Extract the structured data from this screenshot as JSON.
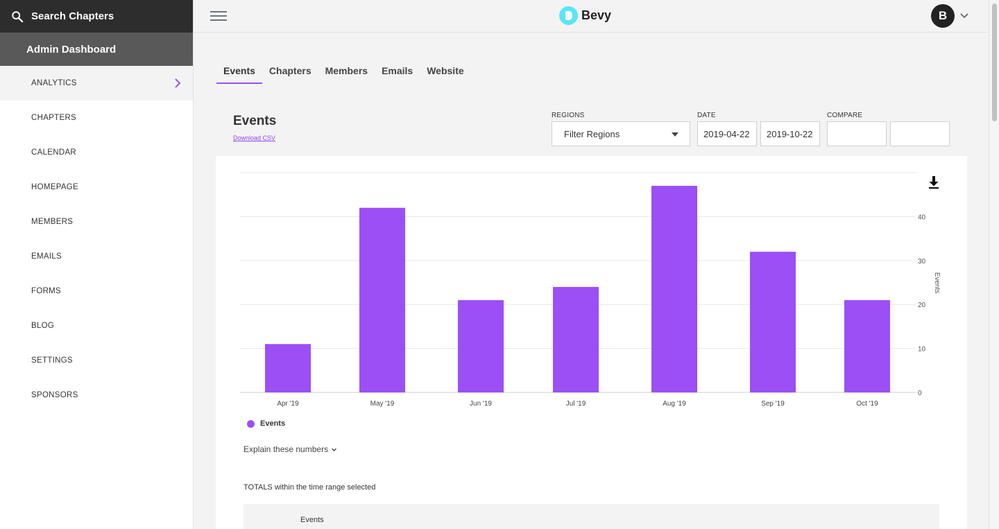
{
  "sidebar": {
    "search_label": "Search Chapters",
    "header": "Admin Dashboard",
    "items": [
      {
        "label": "ANALYTICS",
        "active": true
      },
      {
        "label": "CHAPTERS"
      },
      {
        "label": "CALENDAR"
      },
      {
        "label": "HOMEPAGE"
      },
      {
        "label": "MEMBERS"
      },
      {
        "label": "EMAILS"
      },
      {
        "label": "FORMS"
      },
      {
        "label": "BLOG"
      },
      {
        "label": "SETTINGS"
      },
      {
        "label": "SPONSORS"
      }
    ]
  },
  "header": {
    "logo_text": "Bevy",
    "avatar_initial": "B"
  },
  "tabs": [
    {
      "label": "Events",
      "active": true
    },
    {
      "label": "Chapters"
    },
    {
      "label": "Members"
    },
    {
      "label": "Emails"
    },
    {
      "label": "Website"
    }
  ],
  "section": {
    "title": "Events",
    "download_csv": "Download CSV"
  },
  "filters": {
    "regions_label": "REGIONS",
    "regions_value": "Filter Regions",
    "date_label": "DATE",
    "date_start": "2019-04-22",
    "date_end": "2019-10-22",
    "compare_label": "COMPARE",
    "compare_start": "",
    "compare_end": ""
  },
  "chart_data": {
    "type": "bar",
    "categories": [
      "Apr '19",
      "May '19",
      "Jun '19",
      "Jul '19",
      "Aug '19",
      "Sep '19",
      "Oct '19"
    ],
    "series": [
      {
        "name": "Events",
        "values": [
          11,
          42,
          21,
          24,
          47,
          32,
          21
        ]
      }
    ],
    "ylabel": "Events",
    "ylim": [
      0,
      50
    ],
    "yticks": [
      0,
      10,
      20,
      30,
      40
    ],
    "grid": true,
    "legend": "bottom-left",
    "color": "#9b4ff5",
    "axis_side": "right"
  },
  "explain_label": "Explain these numbers",
  "totals": {
    "label": "TOTALS within the time range selected",
    "column": "Events"
  },
  "colors": {
    "accent": "#9b4ff5",
    "logo": "#5ae6f5",
    "sidebar_dark": "#2d2d2d",
    "sidebar_header": "#595959"
  }
}
